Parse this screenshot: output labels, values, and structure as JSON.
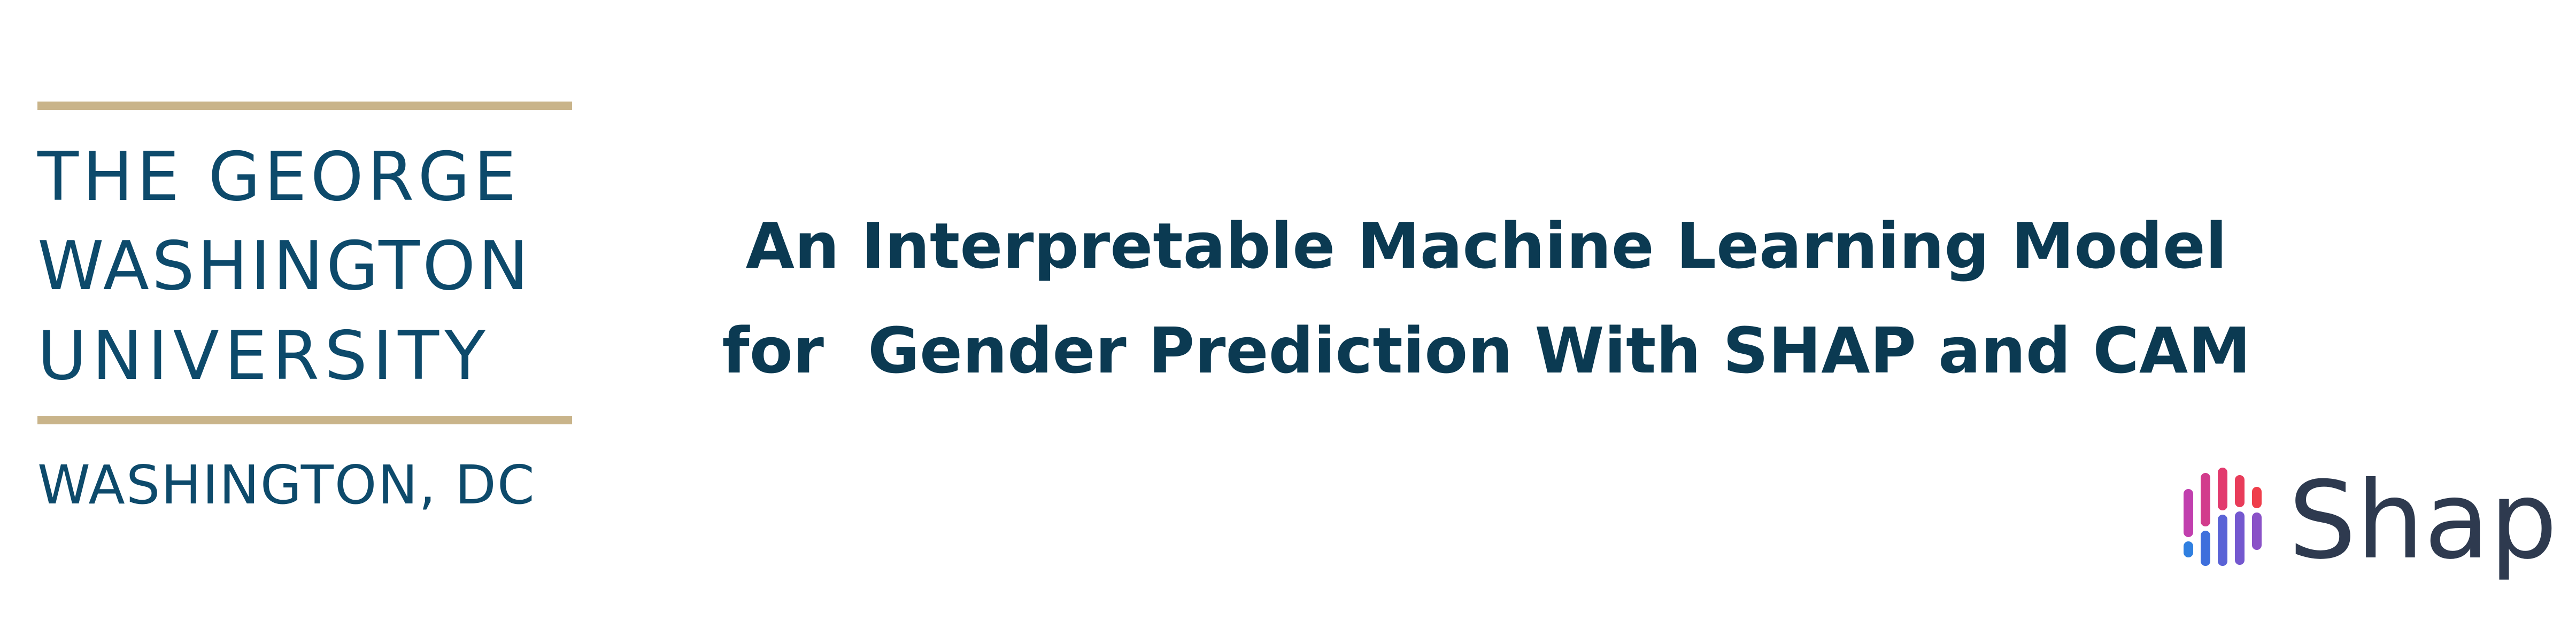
{
  "gwu_logo": {
    "line1": "THE GEORGE",
    "line2": "WASHINGTON",
    "line3": "UNIVERSITY",
    "location": "WASHINGTON, DC",
    "text_color": "#0d4a6b",
    "rule_color": "#c9b48a"
  },
  "title": {
    "line1": "An Interpretable Machine Learning Model",
    "line2": "for  Gender Prediction With SHAP and CAM",
    "color": "#0b3a52"
  },
  "shap_logo": {
    "wordmark": "Shap",
    "icon": "shap-bars-icon",
    "text_color": "#2e3a4f"
  }
}
